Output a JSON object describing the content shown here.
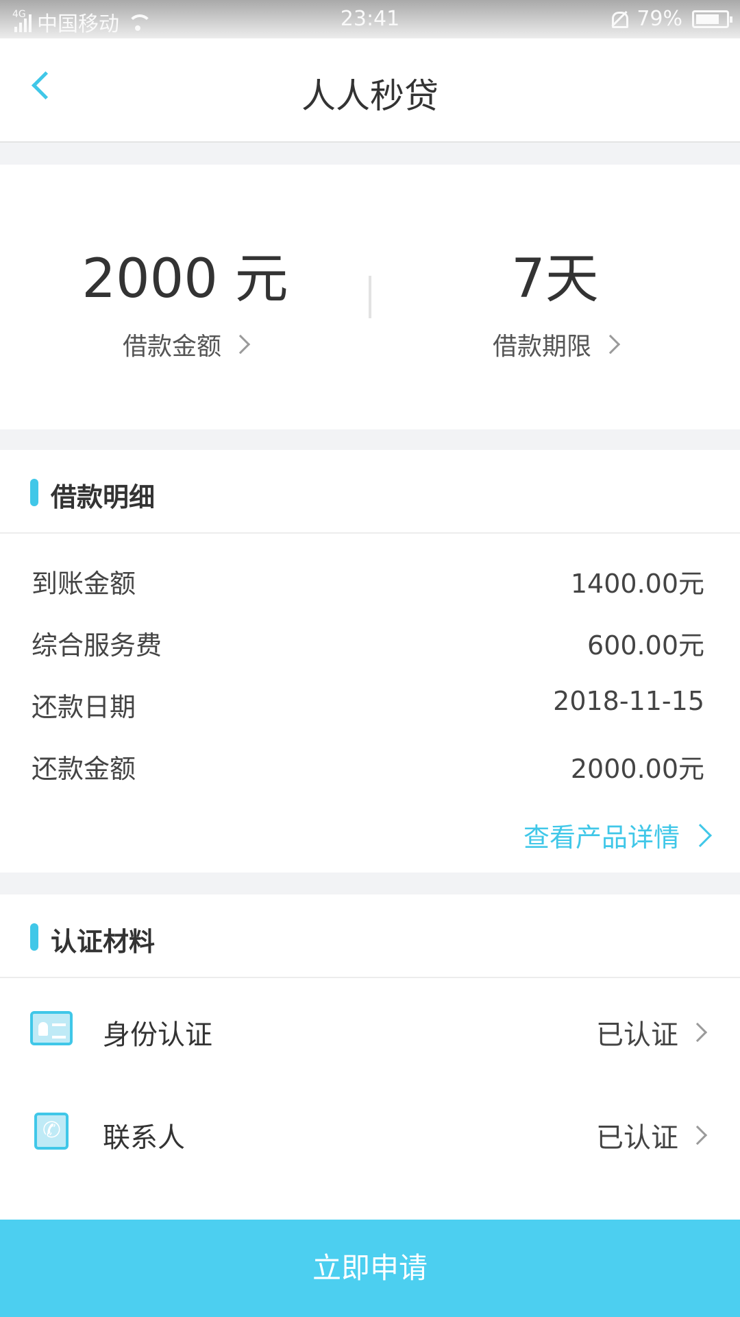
{
  "status_bar": {
    "network": "4G",
    "carrier": "中国移动",
    "time": "23:41",
    "battery": "79%",
    "battery_level": 0.79
  },
  "nav": {
    "title": "人人秒贷",
    "back_icon": "chevron-left-icon"
  },
  "loan": {
    "amount_value": "2000 元",
    "amount_label": "借款金额",
    "term_value": "7天",
    "term_label": "借款期限"
  },
  "details": {
    "title": "借款明细",
    "rows": [
      {
        "label": "到账金额",
        "value": "1400.00元"
      },
      {
        "label": "综合服务费",
        "value": "600.00元"
      },
      {
        "label": "还款日期",
        "value": "2018-11-15"
      },
      {
        "label": "还款金额",
        "value": "2000.00元"
      }
    ],
    "more_link": "查看产品详情"
  },
  "certification": {
    "title": "认证材料",
    "items": [
      {
        "label": "身份认证",
        "status": "已认证",
        "icon": "id-card-icon"
      },
      {
        "label": "联系人",
        "status": "已认证",
        "icon": "contacts-icon"
      }
    ]
  },
  "apply_button": "立即申请",
  "colors": {
    "accent": "#40c7e8",
    "button": "#4ccff0",
    "background": "#f2f3f5"
  }
}
